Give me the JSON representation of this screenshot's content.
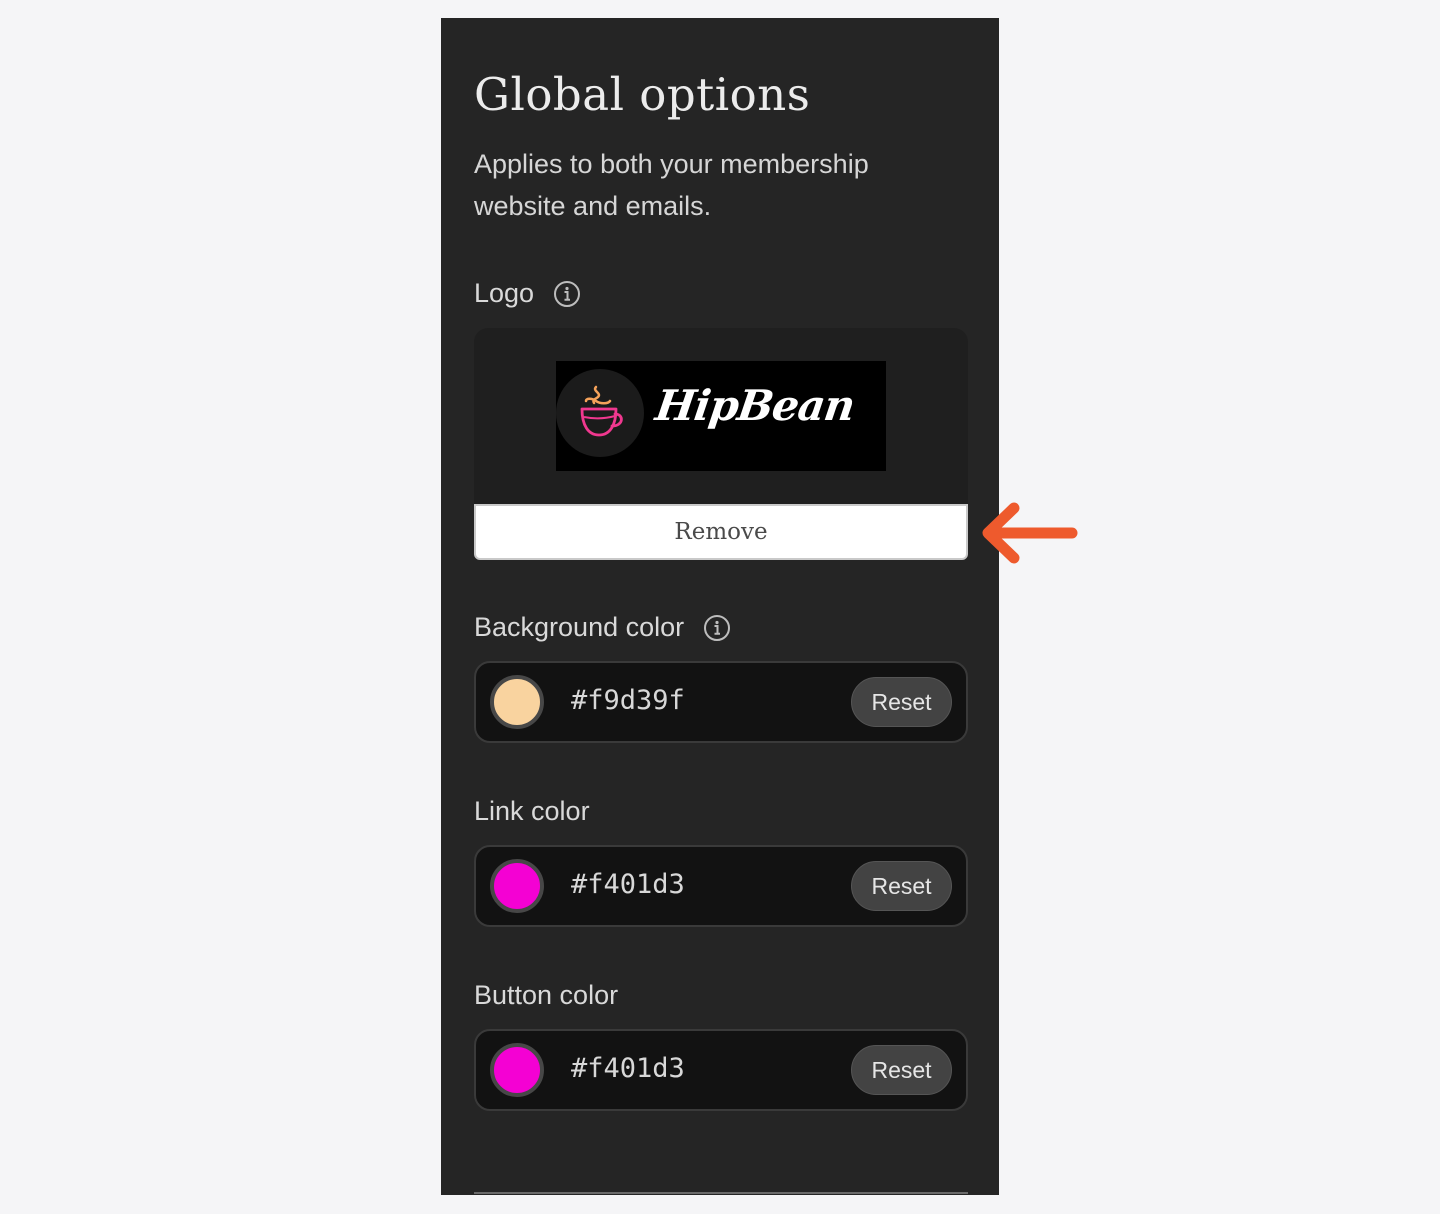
{
  "panel": {
    "title": "Global options",
    "subtitle": "Applies to both your membership website and emails."
  },
  "logo": {
    "label": "Logo",
    "info_icon": "info-icon",
    "image_text": "HipBean",
    "remove_label": "Remove"
  },
  "colors": [
    {
      "label": "Background color",
      "has_info": true,
      "value": "#f9d39f",
      "swatch": "#f9d39f",
      "reset_label": "Reset"
    },
    {
      "label": "Link color",
      "has_info": false,
      "value": "#f401d3",
      "swatch": "#f401d3",
      "reset_label": "Reset"
    },
    {
      "label": "Button color",
      "has_info": false,
      "value": "#f401d3",
      "swatch": "#f401d3",
      "reset_label": "Reset"
    }
  ],
  "annotation": {
    "icon": "arrow-left-icon",
    "color": "#ee5a2d"
  }
}
